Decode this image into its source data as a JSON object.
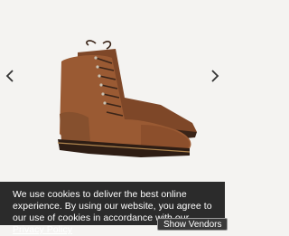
{
  "gallery": {
    "prev_icon": "chevron-left-icon",
    "next_icon": "chevron-right-icon",
    "image": "boot-product-image"
  },
  "cookie_banner": {
    "text_before_link": "We use cookies to deliver the best online experience. By using our website, you agree to our use of cookies in accordance with our ",
    "policy_link": "Privacy Policy",
    "vendors_button": "Show Vendors"
  },
  "colors": {
    "background": "#f4f3f1",
    "banner": "#2b2b2b",
    "leather": "#9a5a33",
    "sole": "#3a2418"
  }
}
